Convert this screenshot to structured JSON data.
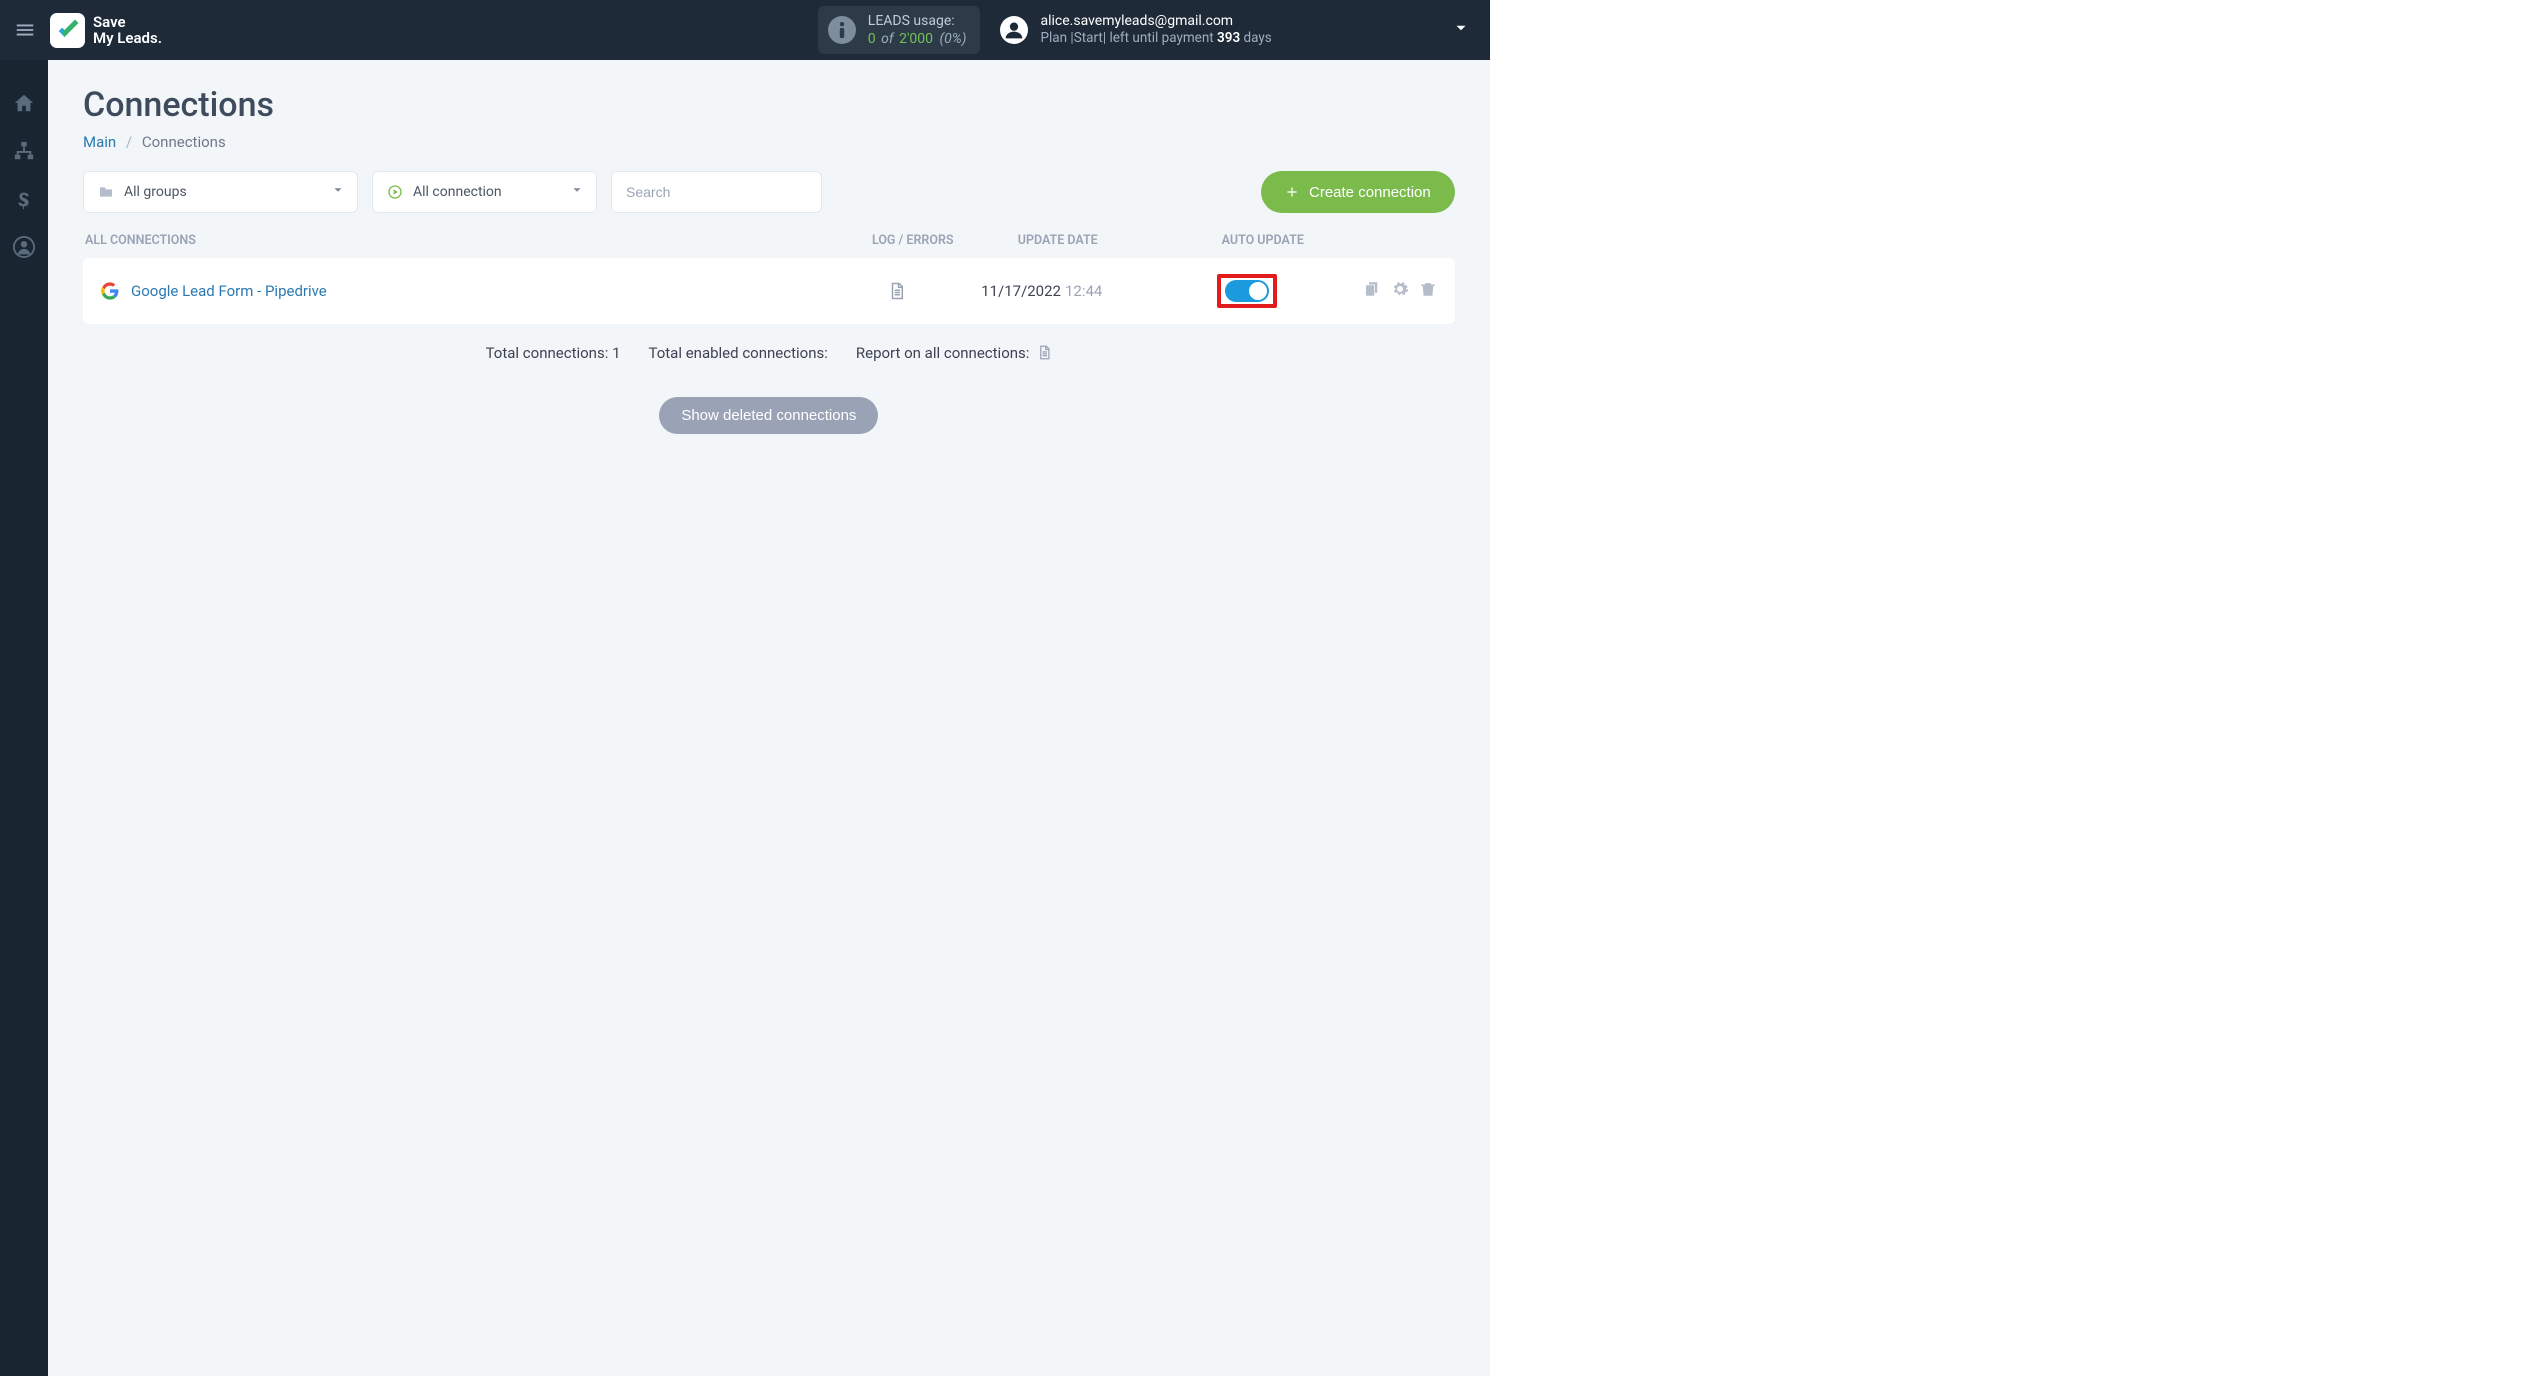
{
  "header": {
    "brand_line1": "Save",
    "brand_line2": "My Leads.",
    "usage": {
      "title": "LEADS usage:",
      "used": "0",
      "of": "of",
      "max": "2'000",
      "pct": "(0%)"
    },
    "account": {
      "email": "alice.savemyleads@gmail.com",
      "plan_prefix": "Plan |",
      "plan_name": "Start",
      "plan_mid": "| left until payment ",
      "days_left": "393",
      "days_label": " days"
    }
  },
  "sidebar": {
    "items": [
      "home",
      "sitemap",
      "billing",
      "account"
    ]
  },
  "page": {
    "title": "Connections",
    "breadcrumb": {
      "main": "Main",
      "current": "Connections"
    }
  },
  "filters": {
    "groups_label": "All groups",
    "conn_label": "All connection",
    "search_placeholder": "Search",
    "create_label": "Create connection"
  },
  "table": {
    "head": {
      "all": "All connections",
      "log": "Log / Errors",
      "date": "Update date",
      "auto": "Auto update"
    },
    "rows": [
      {
        "name": "Google Lead Form - Pipedrive",
        "date": "11/17/2022",
        "time": "12:44",
        "auto_on": true
      }
    ]
  },
  "summary": {
    "total_conn_label": "Total connections: ",
    "total_conn_val": "1",
    "total_enabled_label": "Total enabled connections:",
    "report_label": "Report on all connections:"
  },
  "buttons": {
    "show_deleted": "Show deleted connections"
  }
}
